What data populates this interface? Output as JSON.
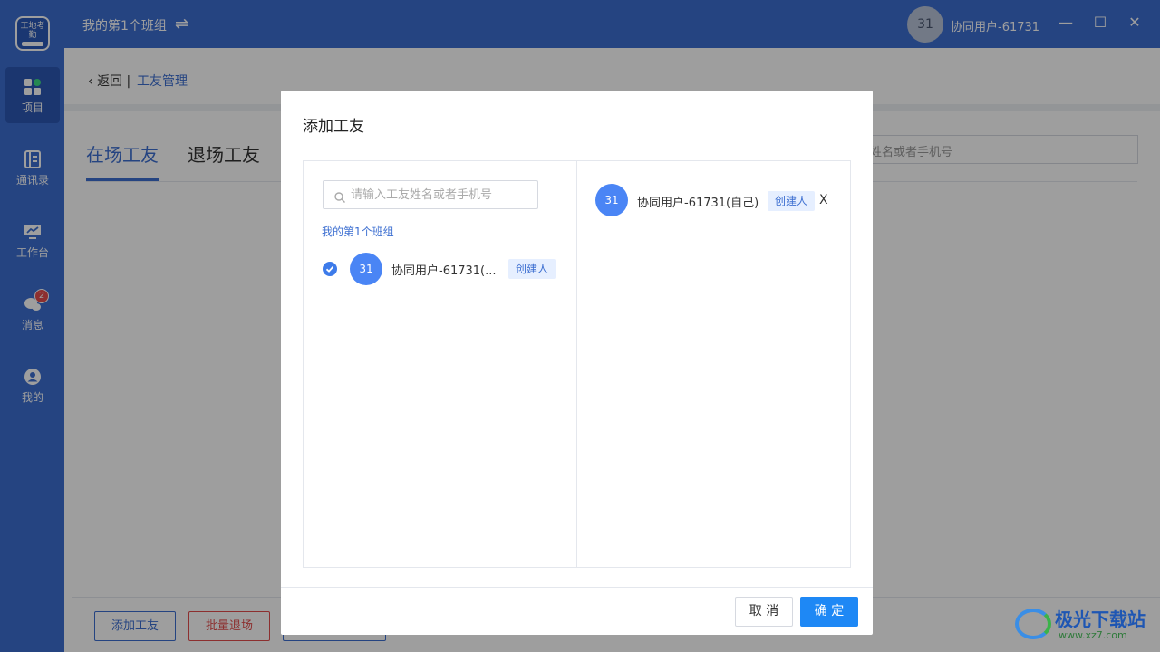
{
  "sidebar": {
    "logo_text": "工地考勤",
    "items": [
      {
        "label": "项目",
        "icon": "grid-icon",
        "active": true
      },
      {
        "label": "通讯录",
        "icon": "contacts-icon"
      },
      {
        "label": "工作台",
        "icon": "workbench-icon"
      },
      {
        "label": "消息",
        "icon": "chat-icon",
        "badge": "2"
      },
      {
        "label": "我的",
        "icon": "user-icon"
      }
    ]
  },
  "topbar": {
    "team_name": "我的第1个班组",
    "switch_glyph": "⇌",
    "avatar_text": "31",
    "user_name": "协同用户-61731",
    "minimize": "—",
    "maximize": "☐",
    "close": "✕"
  },
  "page": {
    "back_label": "返回",
    "breadcrumb_sep": "|",
    "title": "工友管理",
    "tabs": [
      "在场工友",
      "退场工友"
    ],
    "search_placeholder_visible": "姓名或者手机号",
    "bottom_buttons": [
      "添加工友",
      "批量退场"
    ]
  },
  "modal": {
    "title": "添加工友",
    "search_placeholder": "请输入工友姓名或者手机号",
    "group_label": "我的第1个班组",
    "left_member": {
      "avatar": "31",
      "name": "协同用户-61731(...",
      "tag": "创建人",
      "checked": true
    },
    "right_member": {
      "avatar": "31",
      "name": "协同用户-61731(自己)",
      "tag": "创建人",
      "remove": "X"
    },
    "cancel_label": "取 消",
    "ok_label": "确 定"
  },
  "watermark": {
    "text": "极光下载站",
    "url": "www.xz7.com"
  },
  "colors": {
    "primary": "#3d6fd1",
    "button_blue": "#1e88f5",
    "avatar_blue": "#4a85f5",
    "badge_red": "#e34d4d"
  }
}
